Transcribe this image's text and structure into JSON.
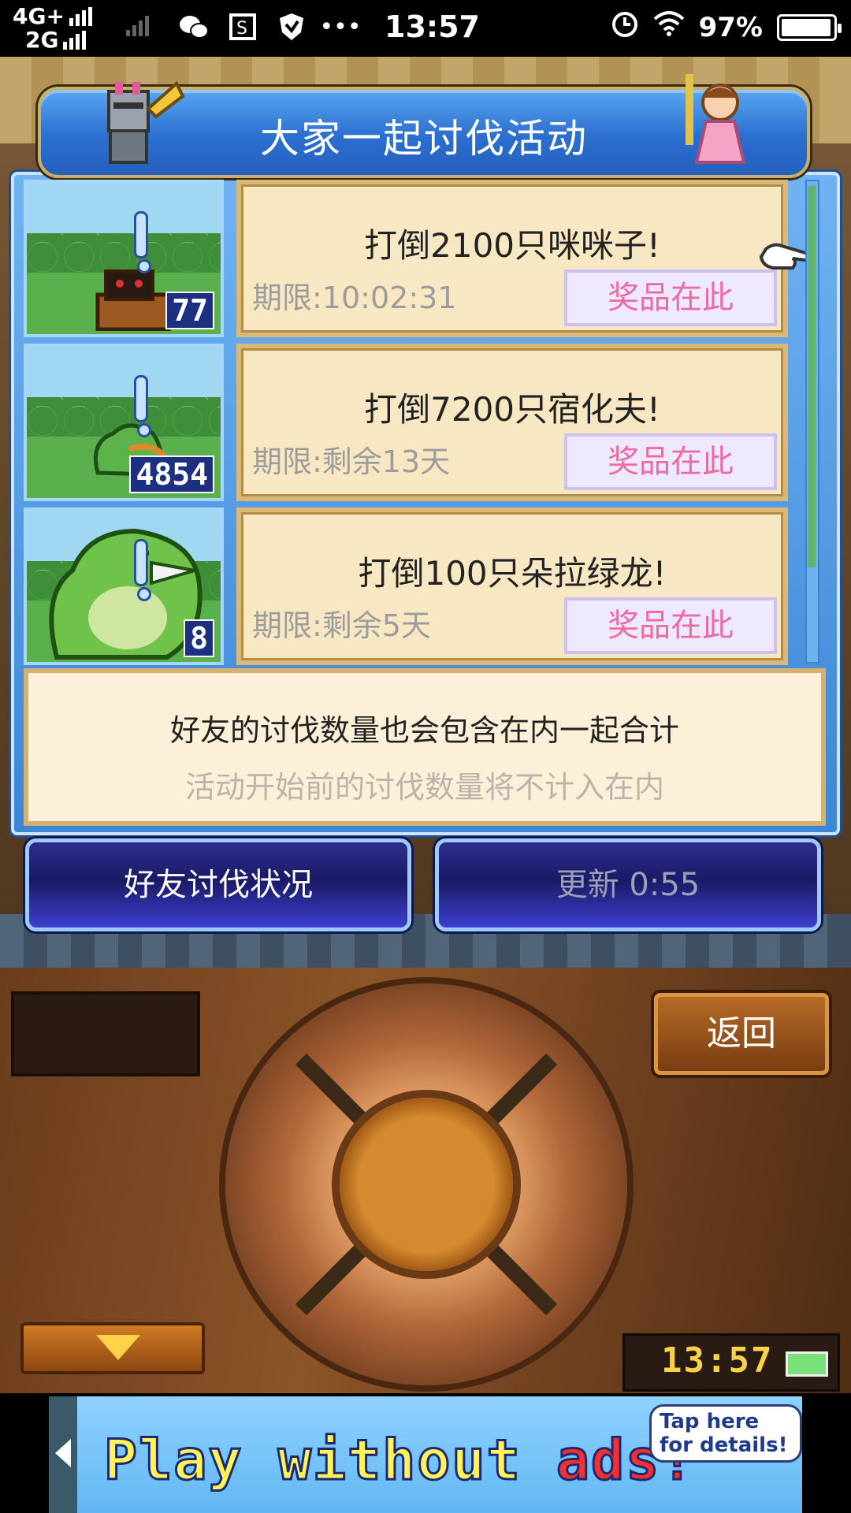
{
  "status_bar": {
    "network_top": "4G+",
    "network_bottom": "2G",
    "time": "13:57",
    "battery": "97%",
    "battery_level": 0.97,
    "icons": [
      "wechat-icon",
      "screenshot-icon",
      "vpn-shield-icon",
      "more-icon",
      "alarm-icon",
      "wifi-icon",
      "battery-icon"
    ]
  },
  "dialog": {
    "title": "大家一起讨伐活动",
    "quests": [
      {
        "count": "77",
        "title": "打倒2100只咪咪子!",
        "limit": "期限:10:02:31",
        "prize_label": "奖品在此",
        "monster_icon": "mimic-chest-monster-icon"
      },
      {
        "count": "4854",
        "title": "打倒7200只宿化夫!",
        "limit": "期限:剩余13天",
        "prize_label": "奖品在此",
        "monster_icon": "green-lizard-monster-icon"
      },
      {
        "count": "8",
        "title": "打倒100只朵拉绿龙!",
        "limit": "期限:剩余5天",
        "prize_label": "奖品在此",
        "monster_icon": "green-dragon-monster-icon"
      }
    ],
    "info_line1": "好友的讨伐数量也会包含在内一起合计",
    "info_line2": "活动开始前的讨伐数量将不计入在内",
    "friend_button": "好友讨伐状况",
    "refresh_button": "更新 0:55"
  },
  "console": {
    "back_button": "返回",
    "clock": "13:57"
  },
  "ad": {
    "text_main": "Play without ",
    "text_red": "ads!",
    "tip": "Tap here for details!"
  },
  "colors": {
    "panel_blue": "#3d86d6",
    "prize_text": "#ee6ba0",
    "card_bg": "#f7e7c3",
    "button_navy": "#1a1a66"
  }
}
